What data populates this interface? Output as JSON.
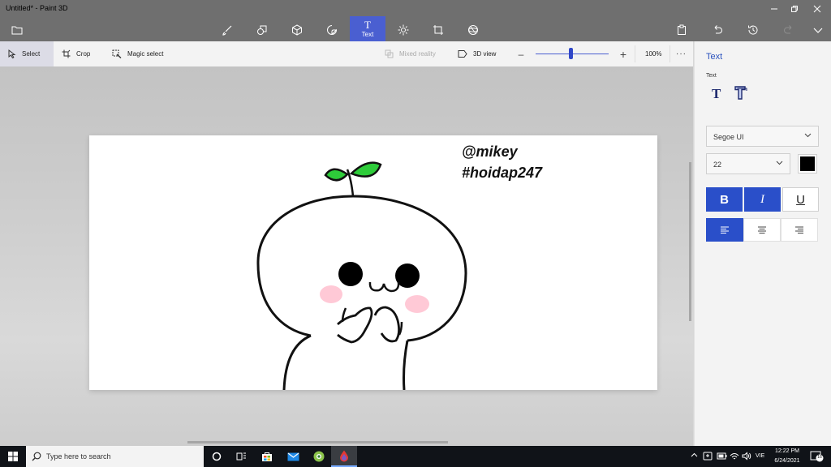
{
  "window": {
    "title": "Untitled* - Paint 3D"
  },
  "ribbon": {
    "tools": [
      {
        "name": "brushes",
        "icon": "brush-icon"
      },
      {
        "name": "2d-shapes",
        "icon": "shapes-2d-icon"
      },
      {
        "name": "3d-shapes",
        "icon": "cube-icon"
      },
      {
        "name": "stickers",
        "icon": "sticker-icon"
      },
      {
        "name": "text",
        "icon": "text-icon",
        "label": "Text",
        "active": true
      },
      {
        "name": "effects",
        "icon": "effects-icon"
      },
      {
        "name": "canvas",
        "icon": "canvas-icon"
      },
      {
        "name": "3d-library",
        "icon": "library-3d-icon"
      }
    ],
    "actions": [
      "paste-icon",
      "undo-icon",
      "history-icon",
      "redo-icon",
      "expand-icon"
    ]
  },
  "toolbar": {
    "select_label": "Select",
    "crop_label": "Crop",
    "magic_select_label": "Magic select",
    "mixed_reality_label": "Mixed reality",
    "view_3d_label": "3D view",
    "zoom_value": "100%",
    "zoom_slider_level": 0.48
  },
  "canvas": {
    "text_line1": "@mikey",
    "text_line2": "#hoidap247"
  },
  "panel": {
    "title": "Text",
    "subtitle": "Text",
    "font_family": "Segoe UI",
    "font_size": "22",
    "text_color": "#000000",
    "bold_label": "B",
    "italic_label": "I",
    "underline_label": "U",
    "bold_active": true,
    "italic_active": true,
    "underline_active": false,
    "align": "left"
  },
  "taskbar": {
    "search_placeholder": "Type here to search",
    "language": "VIE",
    "time": "12:22 PM",
    "date": "6/24/2021",
    "notification_count": "16"
  },
  "colors": {
    "accent": "#4a5fd1",
    "titlebar": "#6f6f6f",
    "sprout_green": "#2ecc3a"
  }
}
